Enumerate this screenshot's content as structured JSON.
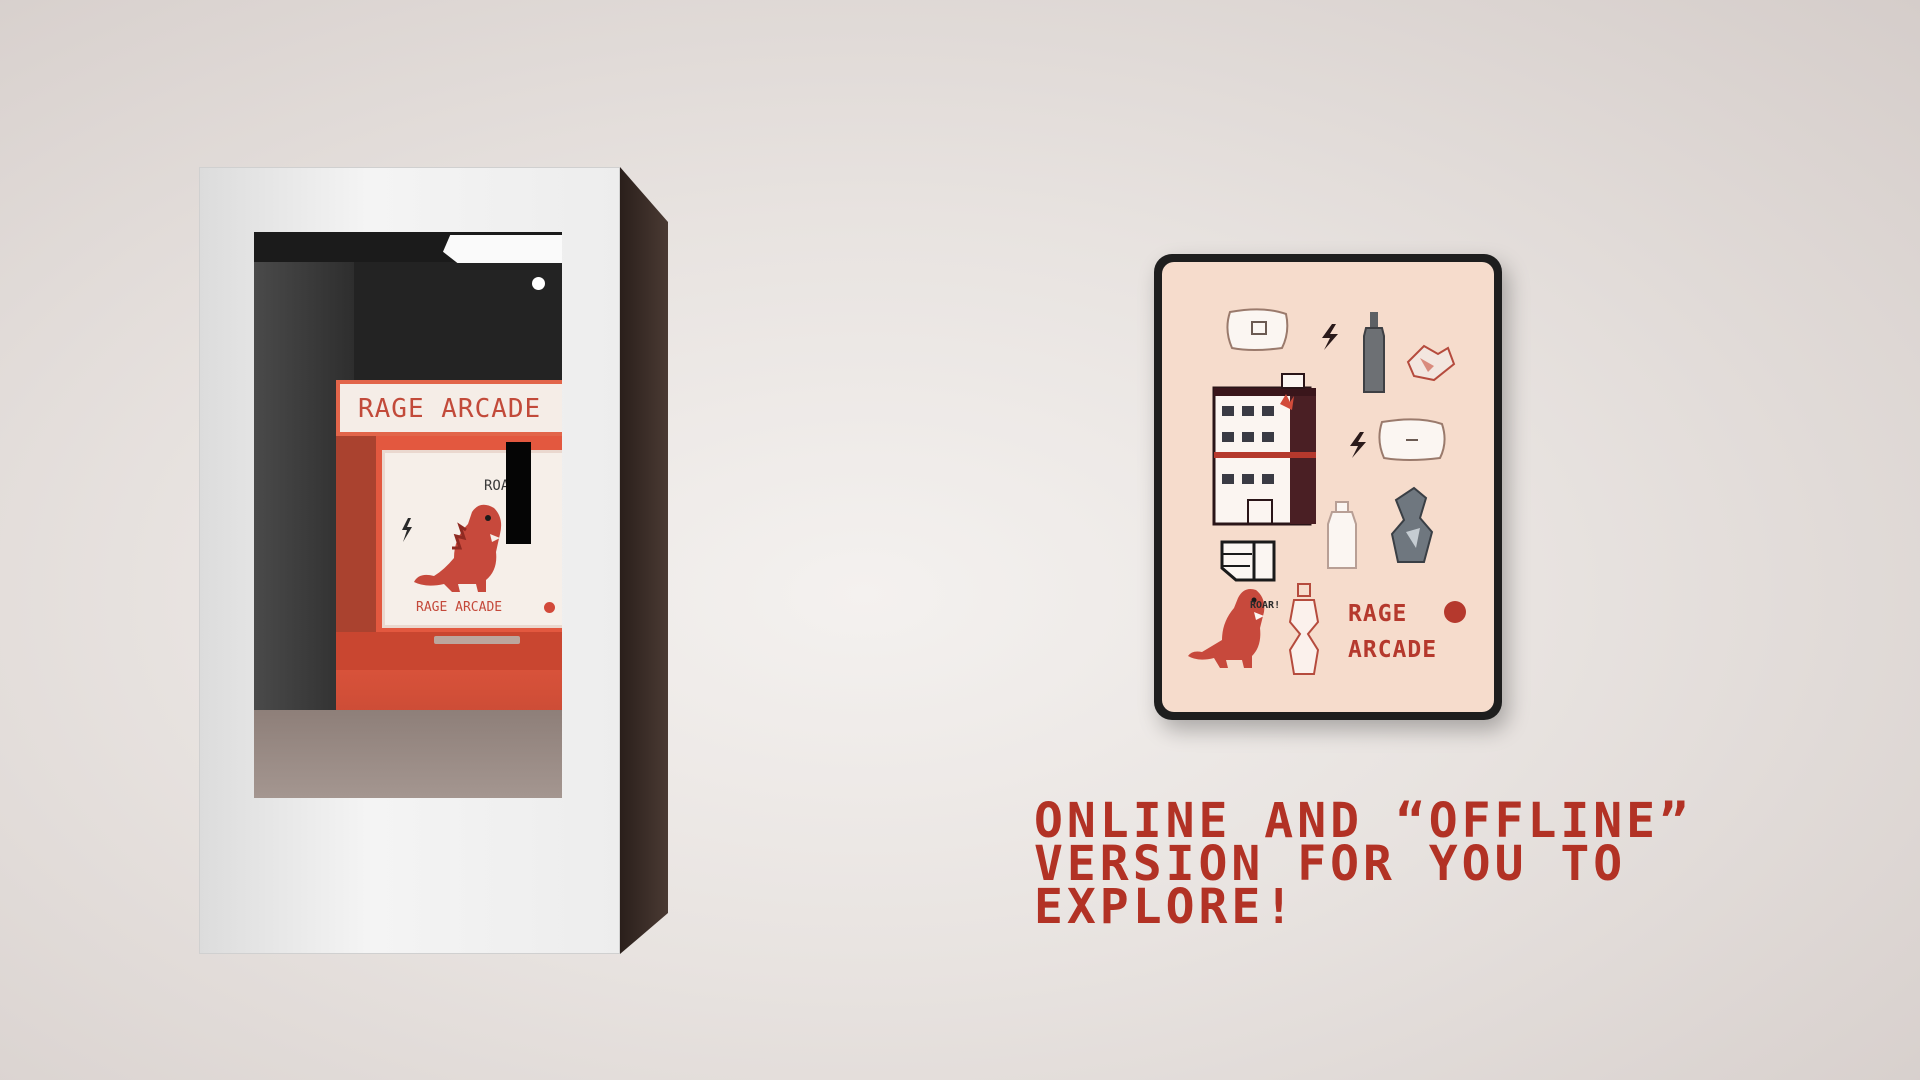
{
  "booth": {
    "arcade_header": "RAGE ARCADE",
    "arcade_screen_label": "RAGE ARCADE",
    "roar": "ROA"
  },
  "tablet": {
    "title_line1": "RAGE",
    "title_line2": "ARCADE",
    "roar": "ROAR!"
  },
  "caption": {
    "line1": "ONLINE AND “OFFLINE”",
    "line2": "VERSION FOR YOU TO",
    "line3": "EXPLORE!"
  },
  "colors": {
    "accent": "#b23225",
    "arcade_orange": "#e3583f",
    "tablet_bg": "#f6dccc"
  }
}
